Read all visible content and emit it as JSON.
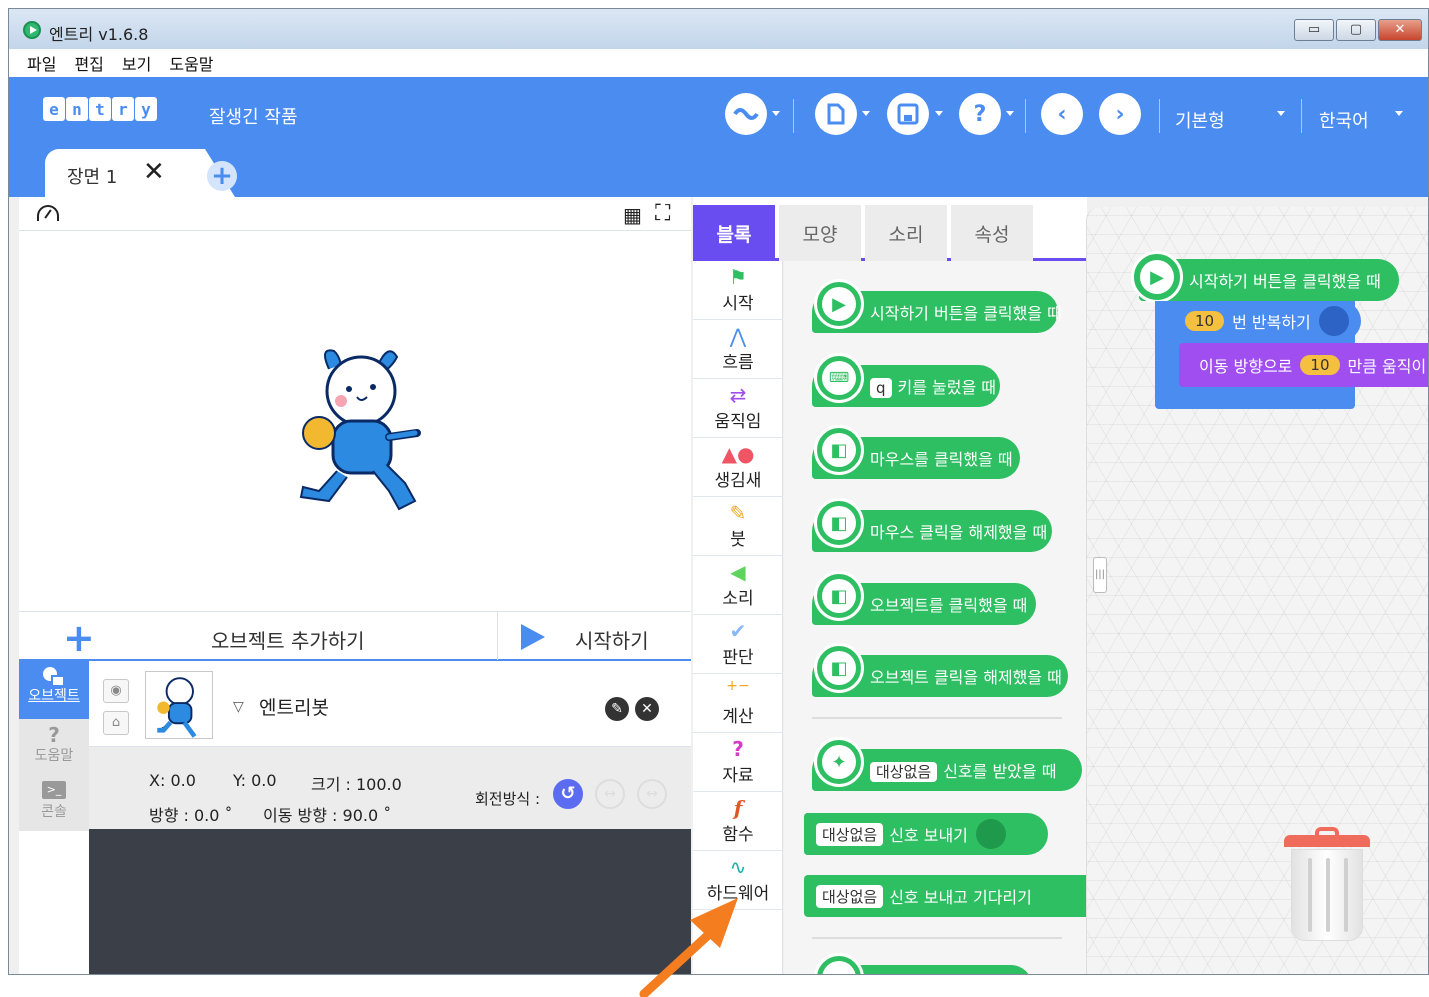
{
  "window": {
    "title": "엔트리 v1.6.8",
    "controls": {
      "minimize": "▭",
      "maximize": "▢",
      "close": "✕"
    }
  },
  "menu": [
    "파일",
    "편집",
    "보기",
    "도움말"
  ],
  "topbar": {
    "logo_letters": [
      "e",
      "n",
      "t",
      "r",
      "y"
    ],
    "project_title": "잘생긴 작품",
    "mode": "기본형",
    "language": "한국어"
  },
  "scene": {
    "label": "장면 1",
    "close": "✕",
    "add": "+"
  },
  "stage_bar": {
    "add_object": "오브젝트 추가하기",
    "start": "시작하기"
  },
  "side_tabs": [
    {
      "label": "오브젝트"
    },
    {
      "label": "도움말"
    },
    {
      "label": "콘솔"
    }
  ],
  "object": {
    "name": "엔트리봇",
    "x": "X: 0.0",
    "y": "Y: 0.0",
    "size": "크기 : 100.0",
    "direction": "방향 : 0.0 ˚",
    "move_direction": "이동 방향 : 90.0 ˚",
    "rotation_label": "회전방식 :"
  },
  "block_tabs": [
    "블록",
    "모양",
    "소리",
    "속성"
  ],
  "categories": [
    {
      "label": "시작",
      "icon": "flag-icon",
      "color": "#2fbf63"
    },
    {
      "label": "흐름",
      "icon": "flow-icon",
      "color": "#4a8cf0"
    },
    {
      "label": "움직임",
      "icon": "arrows-icon",
      "color": "#a14ef0"
    },
    {
      "label": "생김새",
      "icon": "shapes-icon",
      "color": "#ef5565"
    },
    {
      "label": "붓",
      "icon": "brush-icon",
      "color": "#f5a623"
    },
    {
      "label": "소리",
      "icon": "speaker-icon",
      "color": "#5ed35e"
    },
    {
      "label": "판단",
      "icon": "check-icon",
      "color": "#8ab8f7"
    },
    {
      "label": "계산",
      "icon": "calc-icon",
      "color": "#f5a623"
    },
    {
      "label": "자료",
      "icon": "question-icon",
      "color": "#d63cc9"
    },
    {
      "label": "함수",
      "icon": "function-icon",
      "color": "#e25525"
    },
    {
      "label": "하드웨어",
      "icon": "hardware-icon",
      "color": "#14b3a8"
    }
  ],
  "blocks": {
    "start_click": "시작하기 버튼을 클릭했을 때",
    "key_value": "q",
    "key_pressed": "키를 눌렀을 때",
    "mouse_click": "마우스를 클릭했을 때",
    "mouse_release": "마우스 클릭을 해제했을 때",
    "object_click": "오브젝트를 클릭했을 때",
    "object_release": "오브젝트 클릭을 해제했을 때",
    "signal_target": "대상없음",
    "signal_received": "신호를 받았을 때",
    "signal_send": "신호 보내기",
    "signal_send_wait": "신호 보내고 기다리기"
  },
  "workspace": {
    "hat": "시작하기 버튼을 클릭했을 때",
    "repeat_count": "10",
    "repeat_label": "번 반복하기",
    "move_label": "이동 방향으로",
    "move_count": "10",
    "move_suffix": "만큼 움직이"
  }
}
